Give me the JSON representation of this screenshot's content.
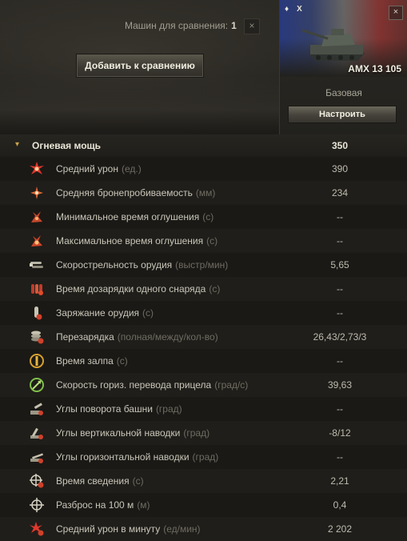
{
  "header": {
    "compare_label": "Машин для сравнения:",
    "compare_count": "1",
    "close_glyph": "×",
    "add_button": "Добавить к сравнению"
  },
  "tank": {
    "tier_glyph": "♦",
    "tier": "X",
    "name": "AMX 13 105",
    "config": "Базовая",
    "setup_button": "Настроить",
    "close_glyph": "×"
  },
  "firepower": {
    "chevron": "▾",
    "title": "Огневая мощь",
    "value": "350",
    "rows": [
      {
        "label": "Средний урон",
        "unit": "(ед.)",
        "value": "390",
        "icon": "damage-icon"
      },
      {
        "label": "Средняя бронепробиваемость",
        "unit": "(мм)",
        "value": "234",
        "icon": "penetration-icon"
      },
      {
        "label": "Минимальное время оглушения",
        "unit": "(с)",
        "value": "--",
        "icon": "stun-min-icon"
      },
      {
        "label": "Максимальное время оглушения",
        "unit": "(с)",
        "value": "--",
        "icon": "stun-max-icon"
      },
      {
        "label": "Скорострельность орудия",
        "unit": "(выстр/мин)",
        "value": "5,65",
        "icon": "rate-of-fire-icon"
      },
      {
        "label": "Время дозарядки одного снаряда",
        "unit": "(с)",
        "value": "--",
        "icon": "shell-reload-icon"
      },
      {
        "label": "Заряжание орудия",
        "unit": "(с)",
        "value": "--",
        "icon": "loading-icon"
      },
      {
        "label": "Перезарядка",
        "unit": "(полная/между/кол-во)",
        "value": "26,43/2,73/3",
        "icon": "magazine-reload-icon"
      },
      {
        "label": "Время залпа",
        "unit": "(с)",
        "value": "--",
        "icon": "salvo-icon"
      },
      {
        "label": "Скорость гориз. перевода прицела",
        "unit": "(град/с)",
        "value": "39,63",
        "icon": "traverse-icon"
      },
      {
        "label": "Углы поворота башни",
        "unit": "(град)",
        "value": "--",
        "icon": "turret-angles-icon"
      },
      {
        "label": "Углы вертикальной наводки",
        "unit": "(град)",
        "value": "-8/12",
        "icon": "elevation-icon"
      },
      {
        "label": "Углы горизонтальной наводки",
        "unit": "(град)",
        "value": "--",
        "icon": "gun-arc-icon"
      },
      {
        "label": "Время сведения",
        "unit": "(с)",
        "value": "2,21",
        "icon": "aim-time-icon"
      },
      {
        "label": "Разброс на 100 м",
        "unit": "(м)",
        "value": "0,4",
        "icon": "dispersion-icon"
      },
      {
        "label": "Средний урон в минуту",
        "unit": "(ед/мин)",
        "value": "2 202",
        "icon": "dpm-icon"
      }
    ]
  }
}
